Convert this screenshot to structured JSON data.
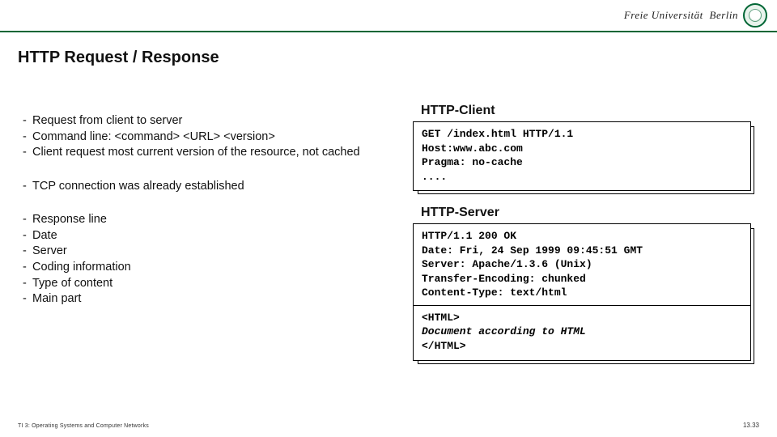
{
  "header": {
    "university": "Freie Universität",
    "city": "Berlin",
    "seal_icon": "university-seal"
  },
  "title": "HTTP Request / Response",
  "left": {
    "group1": [
      "Request from client to server",
      "Command line: <command> <URL> <version>",
      "Client request most current version of the resource, not cached"
    ],
    "group2": [
      "TCP connection was already established"
    ],
    "group3": [
      "Response line",
      "Date",
      "Server",
      "Coding information",
      "Type of content",
      "Main part"
    ]
  },
  "right": {
    "client_label": "HTTP-Client",
    "client_code": "GET /index.html HTTP/1.1\nHost:www.abc.com\nPragma: no-cache\n....",
    "server_label": "HTTP-Server",
    "server_headers": "HTTP/1.1 200 OK\nDate: Fri, 24 Sep 1999 09:45:51 GMT\nServer: Apache/1.3.6 (Unix)\nTransfer-Encoding: chunked\nContent-Type: text/html",
    "server_body_open": "<HTML>",
    "server_body_doc": "Document according to HTML",
    "server_body_close": "</HTML>"
  },
  "footer": {
    "left": "TI 3: Operating Systems and Computer Networks",
    "right": "13.33"
  }
}
